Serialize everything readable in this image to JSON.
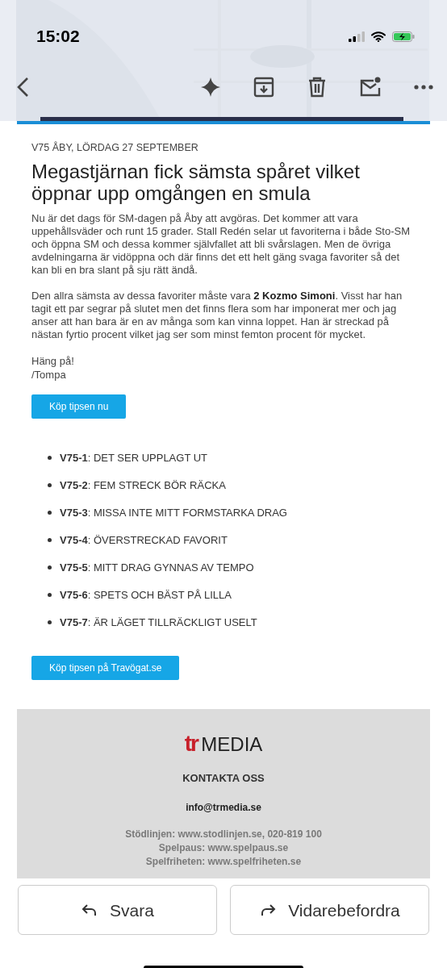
{
  "status_bar": {
    "time": "15:02"
  },
  "toolbar": {
    "actions": [
      {
        "kind": "sparkle"
      },
      {
        "kind": "archive"
      },
      {
        "kind": "delete"
      },
      {
        "kind": "unread"
      },
      {
        "kind": "more"
      }
    ]
  },
  "email": {
    "kicker": "V75 ÅBY, LÖRDAG 27 SEPTEMBER",
    "headline": "Megastjärnan fick sämsta spåret vilket öppnar upp omgången en smula",
    "paragraphs": [
      "Nu är det dags för SM-dagen på Åby att avgöras. Det kommer att vara uppehållsväder och runt 15 grader. Stall Redén selar ut favoriterna i både Sto-SM och öppna SM och dessa kommer självfallet att bli svårslagen. Men de övriga avdelningarna är vidöppna och där finns det ett helt gäng svaga favoriter så det kan bli en bra slant på sju rätt ändå.",
      "Den allra sämsta av dessa favoriter måste vara **2 Kozmo Simoni**. Visst har han tagit ett par segrar på slutet men det finns flera som har imponerat mer och jag anser att han bara är en av många som kan vinna loppet. Han är streckad på nästan fyrtio procent vilket jag ser som minst femton procent för mycket."
    ],
    "signoff": [
      "Häng på!",
      "/Tompa"
    ],
    "button_1": "Köp tipsen nu",
    "races": [
      "**V75-1**: DET SER UPPLAGT UT",
      "**V75-2**: FEM STRECK BÖR RÄCKA",
      "**V75-3**: MISSA INTE MITT FORMSTARKA DRAG",
      "**V75-4**: ÖVERSTRECKAD FAVORIT",
      "**V75-5**: MITT DRAG GYNNAS AV TEMPO",
      "**V75-6**: SPETS OCH BÄST PÅ LILLA",
      "**V75-7**: ÄR LÄGET TILLRÄCKLIGT USELT"
    ],
    "button_2": "Köp tipsen på Travögat.se",
    "footer": {
      "logo_mark": "tr",
      "logo_text": "MEDIA",
      "heading": "KONTAKTA OSS",
      "email": "info@trmedia.se",
      "lines": [
        "Stödlinjen: www.stodlinjen.se, 020-819 100",
        "Spelpaus: www.spelpaus.se",
        "Spelfriheten: www.spelfriheten.se"
      ]
    }
  },
  "actions": [
    {
      "kind": "reply",
      "label": "Svara"
    },
    {
      "kind": "forward",
      "label": "Vidarebefordra"
    }
  ]
}
